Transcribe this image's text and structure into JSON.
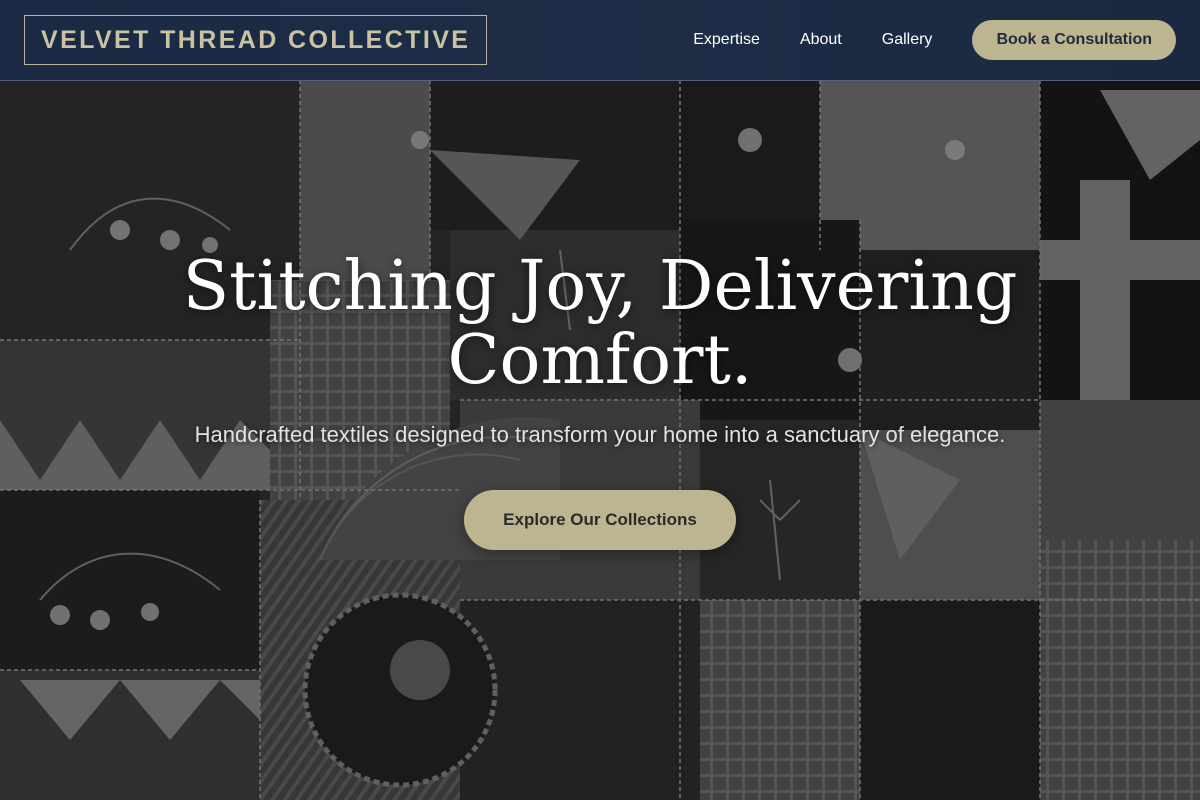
{
  "header": {
    "logo_text": "VELVET THREAD COLLECTIVE",
    "nav": [
      {
        "label": "Expertise"
      },
      {
        "label": "About"
      },
      {
        "label": "Gallery"
      }
    ],
    "cta_label": "Book a Consultation"
  },
  "hero": {
    "title": "Stitching Joy, Delivering Comfort.",
    "subtitle": "Handcrafted textiles designed to transform your home into a sanctuary of elegance.",
    "button_label": "Explore Our Collections",
    "background_image": "grayscale crazy-quilt patchwork with embroidered flowers"
  },
  "colors": {
    "header_bg": "#1e2d47",
    "accent": "#bdb58f",
    "logo_text": "#c9c3a4",
    "title_text": "#ffffff"
  }
}
